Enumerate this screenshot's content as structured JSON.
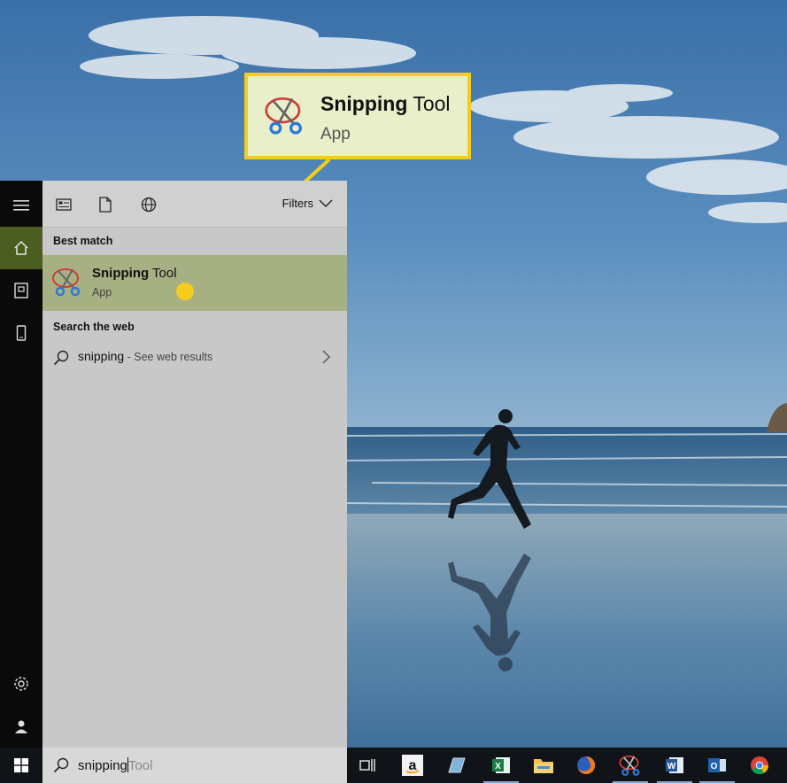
{
  "callout": {
    "title_bold": "Snipping",
    "title_rest": " Tool",
    "subtitle": "App",
    "icon": "snipping-tool-icon",
    "border_color": "#f4cd1c"
  },
  "rail": {
    "items": [
      "hamburger-menu-icon",
      "home-icon",
      "documents-icon",
      "device-icon",
      "settings-icon",
      "user-icon"
    ]
  },
  "header": {
    "icons": [
      "apps-icon",
      "document-icon",
      "web-icon"
    ],
    "filters_label": "Filters"
  },
  "best_match": {
    "heading": "Best match",
    "title_bold": "Snipping",
    "title_rest": " Tool",
    "subtitle": "App"
  },
  "web": {
    "heading": "Search the web",
    "query": "snipping",
    "suffix": " - See web results"
  },
  "search": {
    "typed": "snipping",
    "suggestion": "Tool"
  },
  "taskbar": {
    "apps": [
      "task-view-icon",
      "amazon-icon",
      "notepad-icon",
      "excel-icon",
      "file-explorer-icon",
      "firefox-icon",
      "snipping-tool-icon",
      "word-icon",
      "outlook-icon",
      "chrome-icon"
    ]
  },
  "colors": {
    "accent_green": "#4b5d21",
    "highlight": "#a7b083",
    "callout_yellow": "#f4cd1c"
  }
}
